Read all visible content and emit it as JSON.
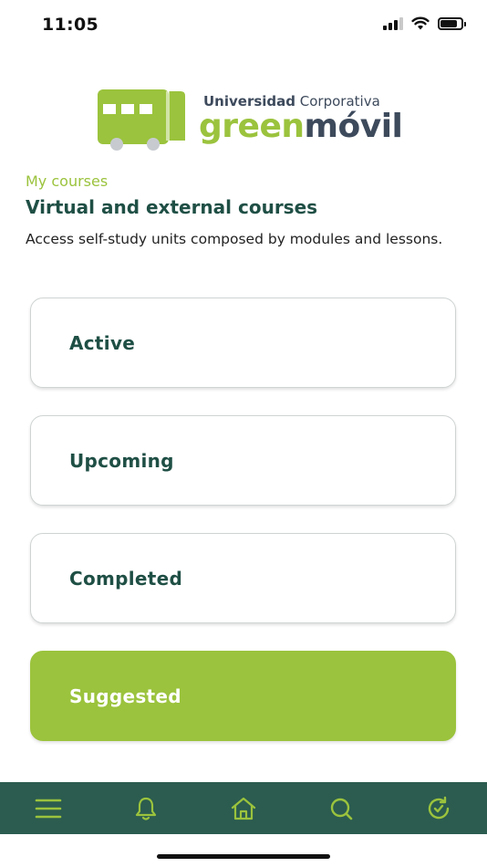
{
  "status_bar": {
    "time": "11:05",
    "battery_level": 0.85,
    "signal_bars_active": 3
  },
  "logo": {
    "line1_strong": "Universidad",
    "line1_rest": " Corporativa",
    "line2_green": "green",
    "line2_navy": "móvil",
    "colors": {
      "green": "#9bc33d",
      "navy": "#3d4a5c"
    }
  },
  "header": {
    "section_label": "My courses",
    "title": "Virtual and external courses",
    "description": "Access self-study units composed by modules and lessons."
  },
  "courses": [
    {
      "label": "Active",
      "highlighted": false
    },
    {
      "label": "Upcoming",
      "highlighted": false
    },
    {
      "label": "Completed",
      "highlighted": false
    },
    {
      "label": "Suggested",
      "highlighted": true
    }
  ],
  "bottom_nav": {
    "items": [
      {
        "icon": "menu-icon"
      },
      {
        "icon": "bell-icon"
      },
      {
        "icon": "home-icon"
      },
      {
        "icon": "search-icon"
      },
      {
        "icon": "history-icon"
      }
    ],
    "background": "#2b5c4f",
    "icon_color": "#9bc33d"
  },
  "colors": {
    "accent": "#9bc33d",
    "primary_text": "#1f4f45",
    "card_border": "#cfd4d3"
  }
}
